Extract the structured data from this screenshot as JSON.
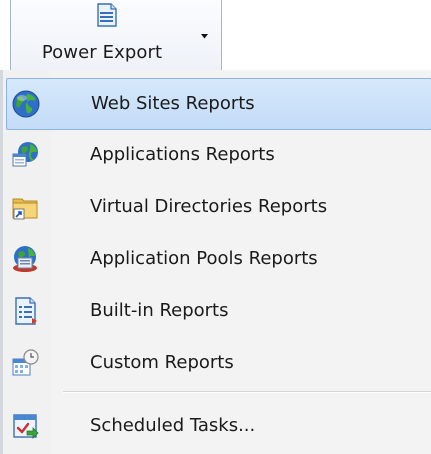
{
  "toolbar": {
    "power_export_label": "Power Export"
  },
  "menu": {
    "items": [
      {
        "label": "Web Sites Reports",
        "icon": "globe-icon"
      },
      {
        "label": "Applications Reports",
        "icon": "application-globe-icon"
      },
      {
        "label": "Virtual Directories Reports",
        "icon": "virtual-directory-folder-icon"
      },
      {
        "label": "Application Pools Reports",
        "icon": "application-pool-icon"
      },
      {
        "label": "Built-in Reports",
        "icon": "report-document-icon"
      },
      {
        "label": "Custom Reports",
        "icon": "custom-report-clock-icon"
      },
      {
        "label": "Scheduled Tasks...",
        "icon": "scheduled-task-check-icon"
      }
    ],
    "highlighted_item": "Web Sites Reports"
  },
  "colors": {
    "highlight_fill": "#c9e0f9",
    "highlight_border": "#8bb4e0",
    "menu_background": "#f3f3f3"
  }
}
